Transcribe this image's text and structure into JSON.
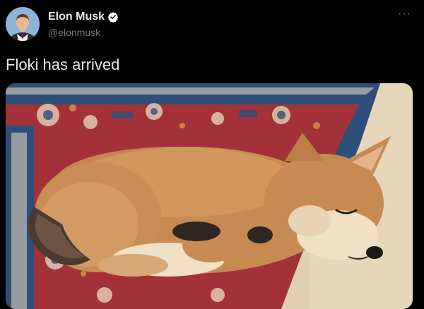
{
  "author": {
    "display_name": "Elon Musk",
    "handle": "@elonmusk",
    "verified": true,
    "verified_color": "#ffffff"
  },
  "more_menu": {
    "icon": "more-horizontal-icon",
    "glyph": "···"
  },
  "tweet": {
    "text": "Floki has arrived"
  },
  "media": {
    "subject": "shiba-inu-puppy-sleeping-on-rug",
    "colors": {
      "floor": "#e0cfb3",
      "rug_red": "#a3313a",
      "rug_blue": "#2d4f7a",
      "rug_cream": "#e9dcc2",
      "puppy_fur": "#c68b52",
      "puppy_light": "#efe0c6"
    }
  },
  "theme": {
    "background": "#000000",
    "text_primary": "#e7e9ea",
    "text_secondary": "#71767b"
  }
}
